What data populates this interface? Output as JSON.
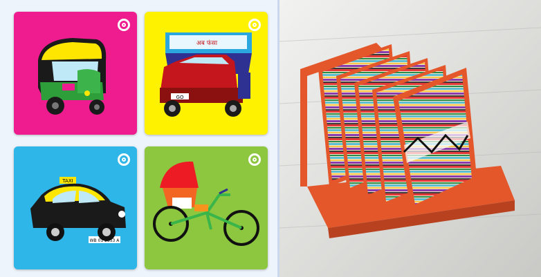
{
  "cards": [
    {
      "id": "auto-rickshaw",
      "bg": "#ee1c8e"
    },
    {
      "id": "truck",
      "bg": "#fff200",
      "truck_text": "अब फंसा",
      "truck_plate": "GO"
    },
    {
      "id": "taxi",
      "bg": "#2fb6e9",
      "taxi_sign": "TAXI",
      "plate": "WB 01 2853 A"
    },
    {
      "id": "cycle-rickshaw",
      "bg": "#8dc63f"
    }
  ],
  "photo": {
    "subject": "coaster-set-with-stand"
  }
}
